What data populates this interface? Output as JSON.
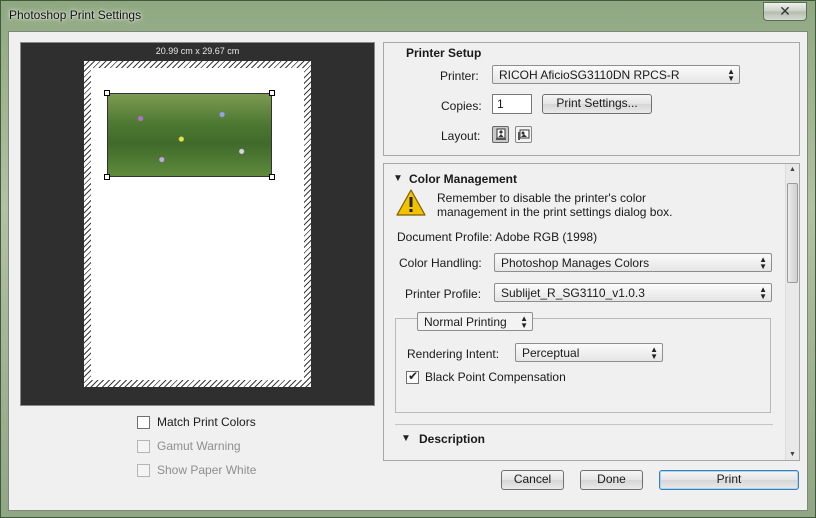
{
  "window": {
    "title": "Photoshop Print Settings",
    "close_glyph": "✕"
  },
  "preview": {
    "dimensions": "20.99 cm x 29.67 cm",
    "options": [
      {
        "label": "Match Print Colors",
        "checked": false,
        "disabled": false
      },
      {
        "label": "Gamut Warning",
        "checked": false,
        "disabled": true
      },
      {
        "label": "Show Paper White",
        "checked": false,
        "disabled": true
      }
    ]
  },
  "printer_setup": {
    "title": "Printer Setup",
    "printer_label": "Printer:",
    "printer_value": "RICOH AficioSG3110DN RPCS-R",
    "copies_label": "Copies:",
    "copies_value": "1",
    "print_settings_button": "Print Settings...",
    "layout_label": "Layout:",
    "layout_options": [
      "portrait-icon",
      "landscape-icon"
    ],
    "layout_selected": "portrait"
  },
  "color_management": {
    "title": "Color Management",
    "warning_icon": "warning-icon",
    "warning_text_line1": "Remember to disable the printer's color",
    "warning_text_line2": "management in the print settings dialog box.",
    "document_profile": "Document Profile: Adobe RGB (1998)",
    "color_handling_label": "Color Handling:",
    "color_handling_value": "Photoshop Manages Colors",
    "printer_profile_label": "Printer Profile:",
    "printer_profile_value": "Sublijet_R_SG3110_v1.0.3",
    "print_mode_value": "Normal Printing",
    "rendering_intent_label": "Rendering Intent:",
    "rendering_intent_value": "Perceptual",
    "black_point_label": "Black Point Compensation",
    "black_point_checked": true
  },
  "description": {
    "title": "Description"
  },
  "footer": {
    "cancel": "Cancel",
    "done": "Done",
    "print": "Print"
  }
}
